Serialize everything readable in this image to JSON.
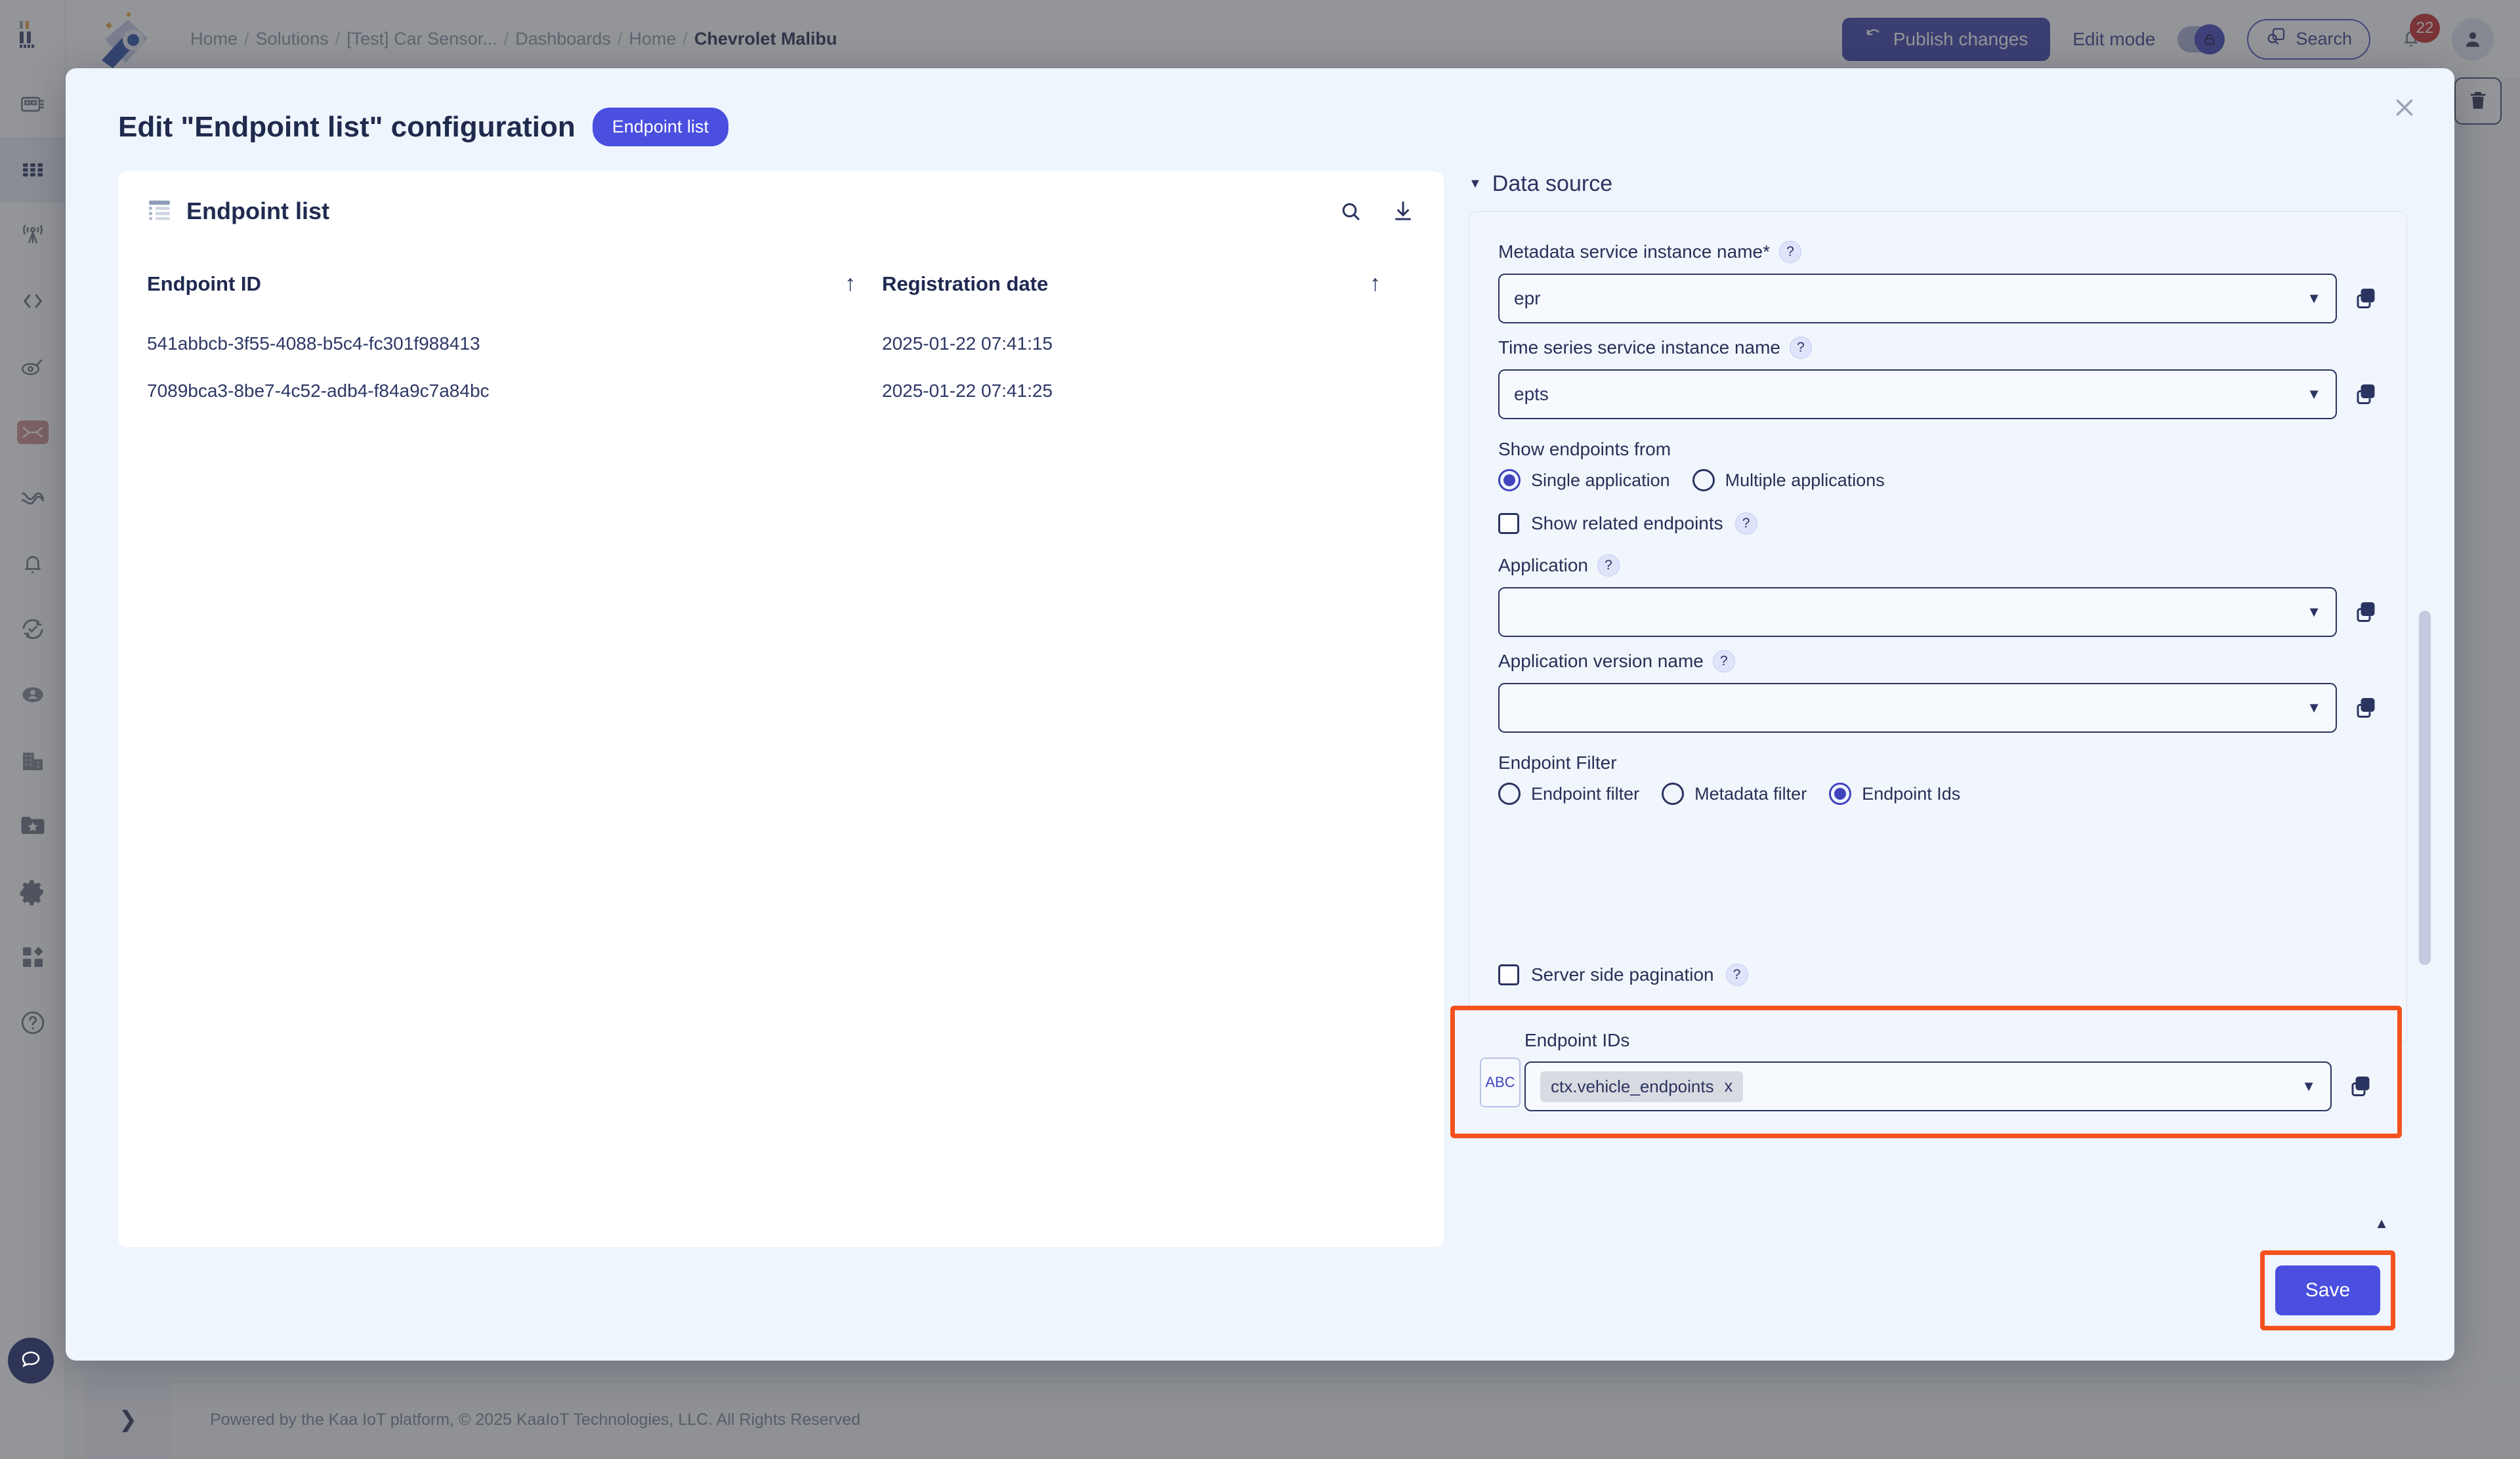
{
  "app": {
    "breadcrumb": [
      {
        "label": "Home",
        "current": false
      },
      {
        "label": "Solutions",
        "current": false
      },
      {
        "label": "[Test] Car Sensor...",
        "current": false
      },
      {
        "label": "Dashboards",
        "current": false
      },
      {
        "label": "Home",
        "current": false
      },
      {
        "label": "Chevrolet Malibu",
        "current": true
      }
    ],
    "publish_button": "Publish changes",
    "edit_mode_label": "Edit mode",
    "search_label": "Search",
    "notification_count": "22",
    "footer": "Powered by the Kaa IoT platform, © 2025 KaaIoT Technologies, LLC. All Rights Reserved",
    "accent": "#4a4fe0",
    "highlight": "#f4511e"
  },
  "sidebar": {
    "items": [
      {
        "icon": "device-chip-icon",
        "name": "sidebar-item-devices",
        "active": false
      },
      {
        "icon": "grid-dashboards-icon",
        "name": "sidebar-item-dashboards",
        "active": true
      },
      {
        "icon": "antenna-signal-icon",
        "name": "sidebar-item-connectivity",
        "active": false
      },
      {
        "icon": "code-brackets-icon",
        "name": "sidebar-item-code",
        "active": false
      },
      {
        "icon": "tag-icon",
        "name": "sidebar-item-tags",
        "active": false
      },
      {
        "icon": "link-broken-icon",
        "name": "sidebar-item-integrations",
        "active": false
      },
      {
        "icon": "analytics-wave-icon",
        "name": "sidebar-item-analytics",
        "active": false
      },
      {
        "icon": "bell-icon",
        "name": "sidebar-item-alerts",
        "active": false
      },
      {
        "icon": "sync-check-icon",
        "name": "sidebar-item-ota",
        "active": false
      },
      {
        "icon": "user-circle-icon",
        "name": "sidebar-item-users",
        "active": false
      },
      {
        "icon": "building-icon",
        "name": "sidebar-item-tenants",
        "active": false
      },
      {
        "icon": "folder-star-icon",
        "name": "sidebar-item-solutions",
        "active": false
      },
      {
        "icon": "gear-icon",
        "name": "sidebar-item-settings",
        "active": false
      },
      {
        "icon": "apps-icon",
        "name": "sidebar-item-apps",
        "active": false
      },
      {
        "icon": "help-circle-icon",
        "name": "sidebar-item-help",
        "active": false
      }
    ]
  },
  "modal": {
    "title": "Edit \"Endpoint list\" configuration",
    "widget_chip": "Endpoint list",
    "close_label": "×"
  },
  "preview": {
    "title": "Endpoint list",
    "actions": [
      {
        "name": "search-icon",
        "label": "Search"
      },
      {
        "name": "download-icon",
        "label": "Download"
      }
    ],
    "table": {
      "columns": [
        {
          "label": "Endpoint ID",
          "sort": "↑"
        },
        {
          "label": "Registration date",
          "sort": "↑"
        }
      ],
      "rows": [
        {
          "endpoint_id": "541abbcb-3f55-4088-b5c4-fc301f988413",
          "registration_date": "2025-01-22 07:41:15"
        },
        {
          "endpoint_id": "7089bca3-8be7-4c52-adb4-f84a9c7a84bc",
          "registration_date": "2025-01-22 07:41:25"
        }
      ]
    }
  },
  "config": {
    "section_title": "Data source",
    "metadata_service": {
      "label": "Metadata service instance name*",
      "value": "epr",
      "help": "?"
    },
    "time_series_service": {
      "label": "Time series service instance name",
      "value": "epts",
      "help": "?"
    },
    "show_endpoints_from": {
      "label": "Show endpoints from",
      "options": [
        {
          "label": "Single application",
          "checked": true
        },
        {
          "label": "Multiple applications",
          "checked": false
        }
      ]
    },
    "show_related_endpoints": {
      "label": "Show related endpoints",
      "checked": false,
      "help": "?"
    },
    "application": {
      "label": "Application",
      "value": "",
      "placeholder": "",
      "help": "?"
    },
    "application_version": {
      "label": "Application version name",
      "value": "",
      "placeholder": "",
      "help": "?"
    },
    "endpoint_filter": {
      "label": "Endpoint Filter",
      "options": [
        {
          "label": "Endpoint filter",
          "checked": false
        },
        {
          "label": "Metadata filter",
          "checked": false
        },
        {
          "label": "Endpoint Ids",
          "checked": true
        }
      ]
    },
    "endpoint_ids": {
      "label": "Endpoint IDs",
      "mode_badge": "ABC",
      "tokens": [
        {
          "label": "ctx.vehicle_endpoints",
          "remove": "x"
        }
      ]
    },
    "server_side_pagination": {
      "label": "Server side pagination",
      "checked": false,
      "help": "?"
    },
    "save_label": "Save"
  }
}
